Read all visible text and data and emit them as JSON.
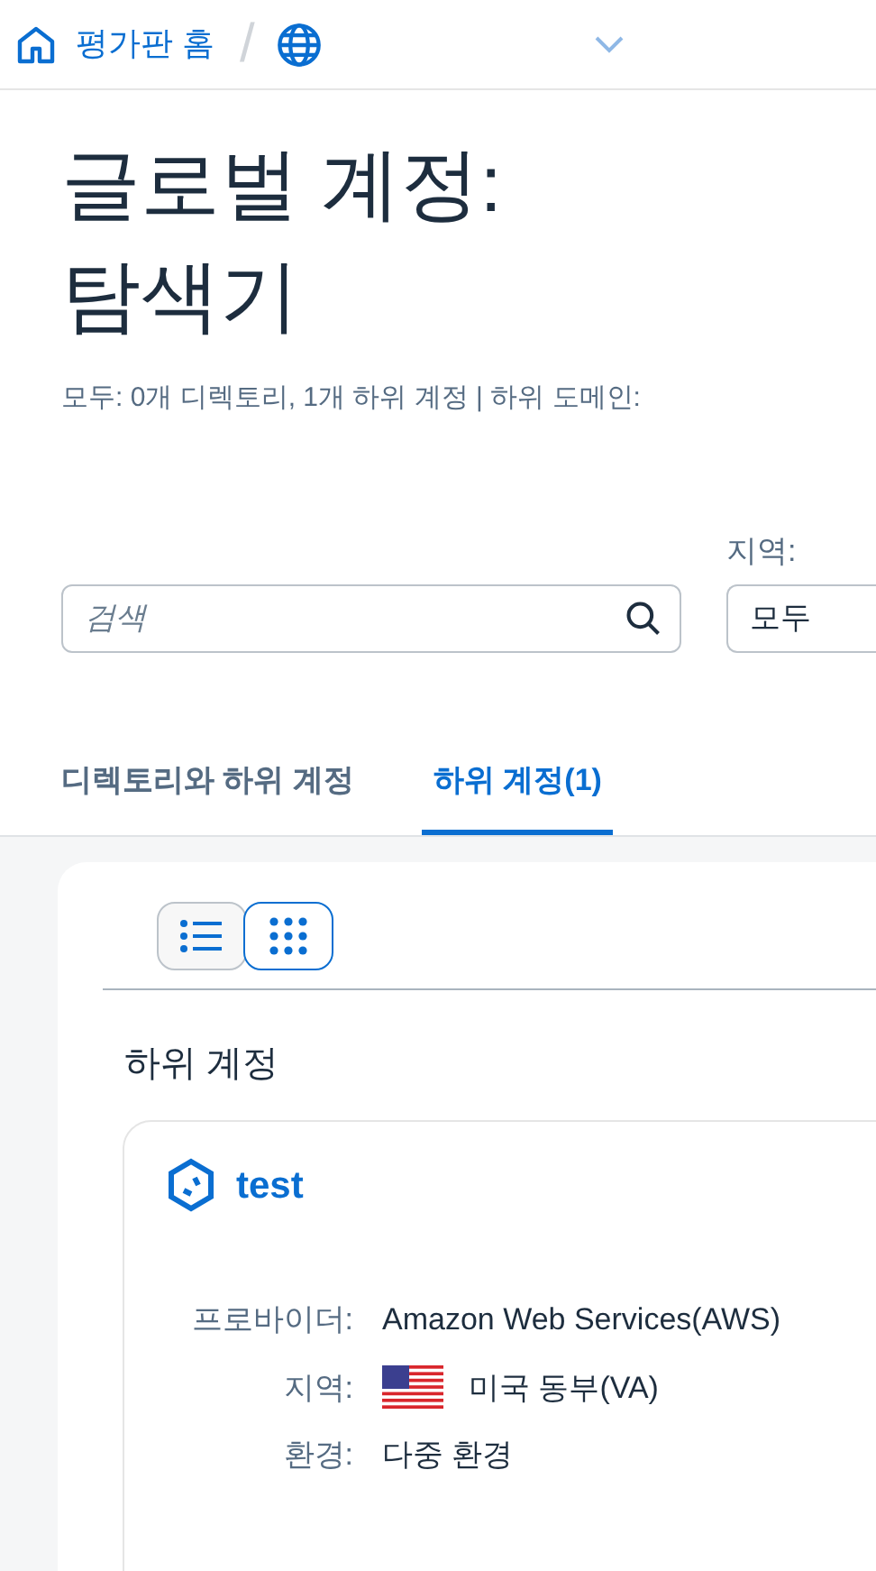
{
  "breadcrumb": {
    "home": "평가판 홈",
    "separator": "/"
  },
  "title": "글로벌 계정:",
  "title_line2": "탐색기",
  "summary": "모두: 0개 디렉토리, 1개 하위 계정 | 하위 도메인:",
  "search": {
    "placeholder": "검색"
  },
  "region_filter": {
    "label": "지역:",
    "value": "모두"
  },
  "tabs": [
    {
      "label": "디렉토리와 하위 계정",
      "selected": false
    },
    {
      "label": "하위 계정(1)",
      "selected": true
    }
  ],
  "view_toggle": [
    {
      "kind": "list",
      "selected": false
    },
    {
      "kind": "grid",
      "selected": true
    }
  ],
  "section_title": "하위 계정",
  "subaccount": {
    "name": "test",
    "fields": [
      {
        "label": "프로바이더:",
        "value": "Amazon Web Services(AWS)"
      },
      {
        "label": "지역:",
        "value": "미국 동부(VA)",
        "kind": "flag"
      },
      {
        "label": "환경:",
        "value": "다중 환경"
      }
    ]
  }
}
